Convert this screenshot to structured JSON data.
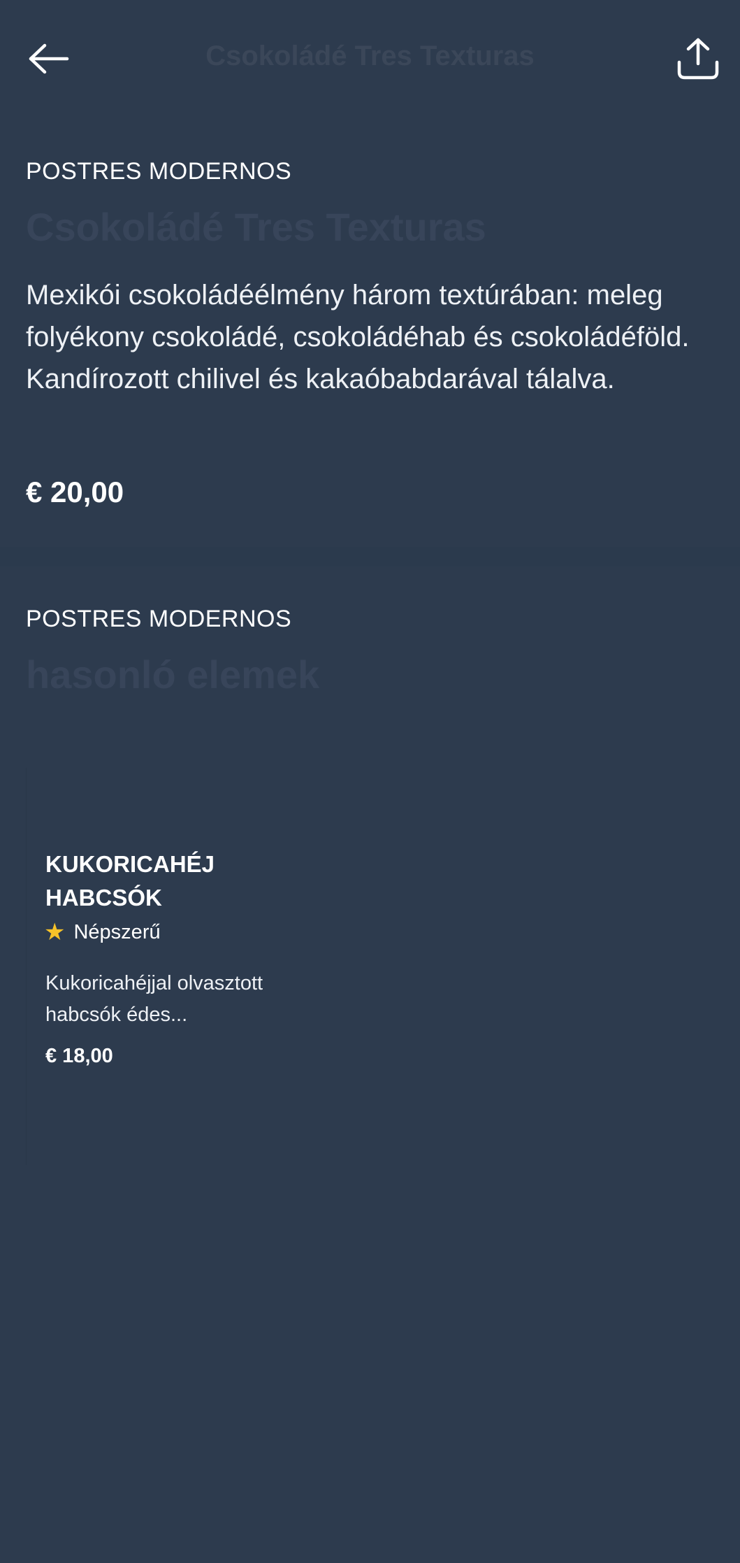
{
  "header": {
    "title": "Csokoládé Tres Texturas",
    "back_icon": "arrow-left-icon",
    "share_icon": "share-icon"
  },
  "detail": {
    "category": "POSTRES MODERNOS",
    "title": "Csokoládé Tres Texturas",
    "description": "Mexikói csokoládéélmény három textúrában: meleg folyékony csokoládé, csokoládéhab és csokoládéföld. Kandírozott chilivel és kakaóbabdarával tálalva.",
    "price": "€ 20,00"
  },
  "similar": {
    "category": "POSTRES MODERNOS",
    "title": "hasonló elemek",
    "items": [
      {
        "name": "KUKORICAHÉJ HABCSÓK",
        "badge": "Népszerű",
        "badge_icon": "star-icon",
        "description": "Kukoricahéjjal olvasztott habcsók édes...",
        "price": "€ 18,00"
      }
    ]
  },
  "colors": {
    "background": "#2d3b4e",
    "text": "#ffffff",
    "muted_title": "#38455a",
    "star": "#f6c229"
  }
}
